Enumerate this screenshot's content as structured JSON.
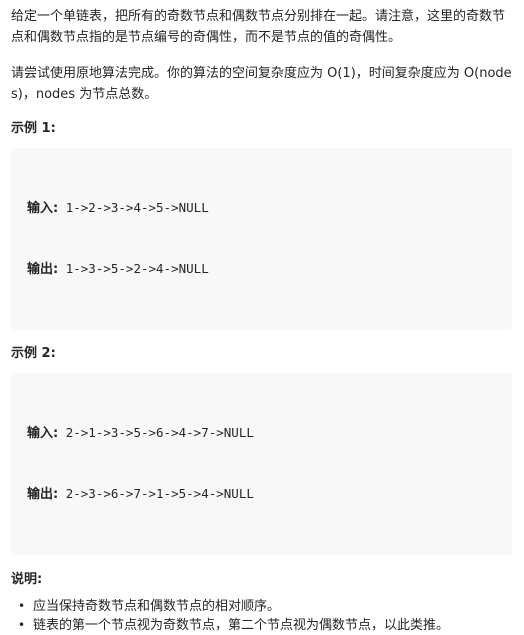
{
  "description": {
    "paragraph_1": "给定一个单链表，把所有的奇数节点和偶数节点分别排在一起。请注意，这里的奇数节点和偶数节点指的是节点编号的奇偶性，而不是节点的值的奇偶性。",
    "paragraph_2": "请尝试使用原地算法完成。你的算法的空间复杂度应为 O(1)，时间复杂度应为 O(nodes)，nodes 为节点总数。"
  },
  "examples": [
    {
      "heading": "示例 1:",
      "input_label": "输入:",
      "input_value": " 1->2->3->4->5->NULL",
      "output_label": "输出:",
      "output_value": " 1->3->5->2->4->NULL"
    },
    {
      "heading": "示例 2:",
      "input_label": "输入:",
      "input_value": " 2->1->3->5->6->4->7->NULL",
      "output_label": "输出:",
      "output_value": " 2->3->6->7->1->5->4->NULL"
    }
  ],
  "notes": {
    "heading": "说明:",
    "bullet_glyph": "•",
    "items": [
      "应当保持奇数节点和偶数节点的相对顺序。",
      "链表的第一个节点视为奇数节点，第二个节点视为偶数节点，以此类推。"
    ]
  }
}
